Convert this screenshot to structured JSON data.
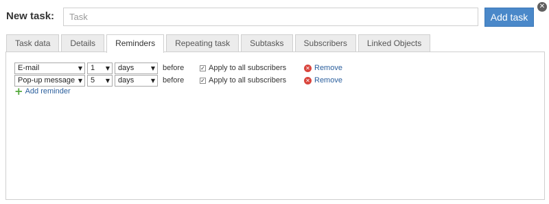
{
  "header": {
    "title": "New task:",
    "task_placeholder": "Task",
    "add_button": "Add task",
    "close_icon": "close-icon"
  },
  "tabs": [
    {
      "label": "Task data",
      "active": false
    },
    {
      "label": "Details",
      "active": false
    },
    {
      "label": "Reminders",
      "active": true
    },
    {
      "label": "Repeating task",
      "active": false
    },
    {
      "label": "Subtasks",
      "active": false
    },
    {
      "label": "Subscribers",
      "active": false
    },
    {
      "label": "Linked Objects",
      "active": false
    }
  ],
  "reminders": [
    {
      "type": "E-mail",
      "amount": "1",
      "unit": "days",
      "before": "before",
      "apply_checked": true,
      "apply_label": "Apply to all subscribers",
      "remove": "Remove"
    },
    {
      "type": "Pop-up message",
      "amount": "5",
      "unit": "days",
      "before": "before",
      "apply_checked": true,
      "apply_label": "Apply to all subscribers",
      "remove": "Remove"
    }
  ],
  "add_reminder": "Add reminder",
  "colors": {
    "accent": "#4a88c9",
    "link": "#2a5e9c",
    "remove": "#d9453d",
    "add": "#52a83a"
  }
}
